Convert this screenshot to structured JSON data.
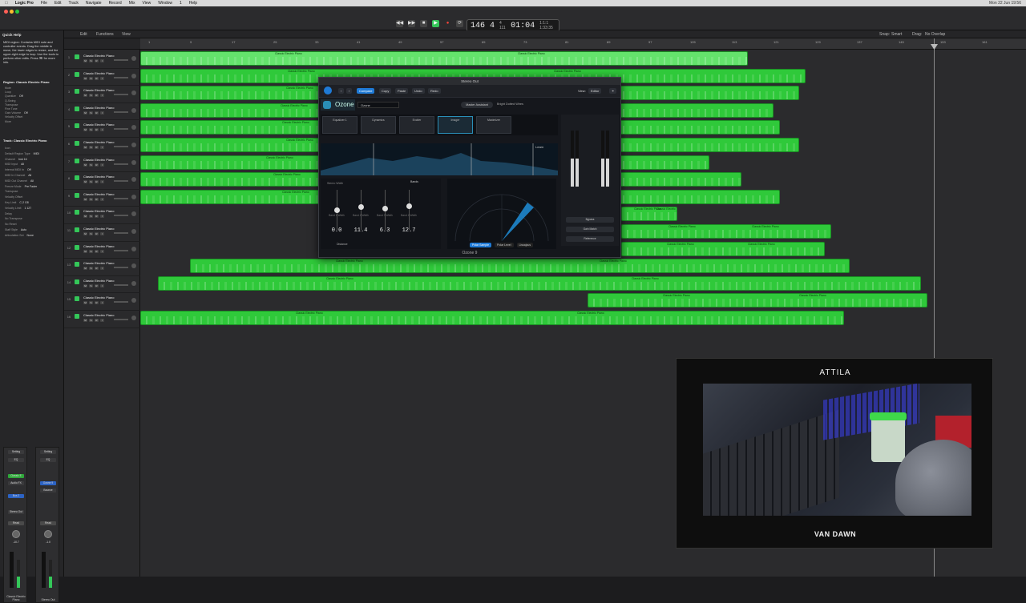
{
  "menubar": {
    "app": "Logic Pro",
    "items": [
      "File",
      "Edit",
      "Track",
      "Navigate",
      "Record",
      "Mix",
      "View",
      "Window",
      "1",
      "Help"
    ],
    "clock": "Mon 22 Jun 19:56"
  },
  "window": {
    "title": "Stereo Out"
  },
  "lcd": {
    "tempo": "146",
    "sig": "4",
    "sig_sub": "4 111",
    "position": "01:04",
    "small": "1:1:1 1:33:35"
  },
  "toolbar2": {
    "edit": "Edit",
    "functions": "Functions",
    "view": "View",
    "snap_label": "Snap:",
    "snap_value": "Smart",
    "drag_label": "Drag:",
    "drag_value": "No Overlap"
  },
  "inspector": {
    "quick_help_title": "Quick Help",
    "help_text": "MIDI region: Contains MIDI note and controller events. Drag the middle to move, the lower edges to resize, and the upper-right edge to loop. Use the tools to perform other edits. Press ⌘/ for more info.",
    "region_title": "Region: Classic Electric Piano",
    "region_fields": [
      {
        "k": "Mute",
        "v": ""
      },
      {
        "k": "Loop",
        "v": ""
      },
      {
        "k": "Quantize",
        "v": "Off"
      },
      {
        "k": "Q-Swing",
        "v": ""
      },
      {
        "k": "Transpose",
        "v": ""
      },
      {
        "k": "Fine Tune",
        "v": ""
      },
      {
        "k": "Gain Volume",
        "v": "Off"
      },
      {
        "k": "Velocity Offset",
        "v": ""
      },
      {
        "k": "More",
        "v": ""
      }
    ],
    "track_title": "Track: Classic Electric Piano",
    "track_fields": [
      {
        "k": "Icon",
        "v": ""
      },
      {
        "k": "Default Region Type",
        "v": "MIDI"
      },
      {
        "k": "Channel",
        "v": "Inst 16"
      },
      {
        "k": "MIDI Input",
        "v": "All"
      },
      {
        "k": "Internal MIDI In",
        "v": "Off"
      },
      {
        "k": "MIDI In Channel",
        "v": "All"
      },
      {
        "k": "MIDI Out Channel",
        "v": "All"
      },
      {
        "k": "Freeze Mode",
        "v": "Pre Fader"
      },
      {
        "k": "Transpose",
        "v": ""
      },
      {
        "k": "Velocity Offset",
        "v": ""
      },
      {
        "k": "Key Limit",
        "v": "C-2 G8"
      },
      {
        "k": "Velocity Limit",
        "v": "1 127"
      },
      {
        "k": "Delay",
        "v": ""
      },
      {
        "k": "No Transpose",
        "v": ""
      },
      {
        "k": "No Reset",
        "v": ""
      },
      {
        "k": "Staff Style",
        "v": "Auto"
      },
      {
        "k": "Articulation Set",
        "v": "None"
      }
    ],
    "strips": [
      {
        "setting": "Setting",
        "eq": "EQ",
        "plugin": "Classic E",
        "audio_fx": "Audio FX",
        "bus": "Bus 2",
        "stereo": "Stereo Out",
        "read": "Read",
        "pan": "0.0",
        "level": "-10.7",
        "name": "Classic Electric Piano"
      },
      {
        "setting": "Setting",
        "eq": "EQ",
        "plugin": "Ozone 9",
        "audio_fx": "Bounce",
        "bus": "",
        "stereo": "",
        "read": "Read",
        "pan": "0.0",
        "level": "-1.0",
        "name": "Stereo Out"
      }
    ]
  },
  "tracks": [
    {
      "num": "1",
      "name": "Classic Electric Piano"
    },
    {
      "num": "2",
      "name": "Classic Electric Piano"
    },
    {
      "num": "3",
      "name": "Classic Electric Piano"
    },
    {
      "num": "4",
      "name": "Classic Electric Piano"
    },
    {
      "num": "5",
      "name": "Classic Electric Piano"
    },
    {
      "num": "6",
      "name": "Classic Electric Piano"
    },
    {
      "num": "7",
      "name": "Classic Electric Piano"
    },
    {
      "num": "8",
      "name": "Classic Electric Piano"
    },
    {
      "num": "9",
      "name": "Classic Electric Piano"
    },
    {
      "num": "10",
      "name": "Classic Electric Piano"
    },
    {
      "num": "11",
      "name": "Classic Electric Piano"
    },
    {
      "num": "12",
      "name": "Classic Electric Piano"
    },
    {
      "num": "13",
      "name": "Classic Electric Piano"
    },
    {
      "num": "14",
      "name": "Classic Electric Piano"
    },
    {
      "num": "15",
      "name": "Classic Electric Piano"
    },
    {
      "num": "16",
      "name": "Classic Electric Piano"
    }
  ],
  "track_buttons": [
    "M",
    "S",
    "R",
    "I"
  ],
  "ruler": [
    "1",
    "9",
    "17",
    "25",
    "33",
    "41",
    "49",
    "57",
    "65",
    "73",
    "81",
    "89",
    "97",
    "105",
    "113",
    "121",
    "129",
    "137",
    "145",
    "153",
    "161"
  ],
  "region_label": "Classic Electric Piano",
  "plugin": {
    "window_title": "Stereo Out",
    "nav": [
      "Compare",
      "Copy",
      "Paste",
      "Undo",
      "Redo"
    ],
    "view_label": "View:",
    "view_value": "Editor",
    "brand": "Ozone",
    "preset": "Ozone",
    "assistant": "Master Assistant",
    "assistant_info": "Bright Dotted Wires",
    "modules": [
      "Equalizer 1",
      "Dynamics",
      "Exciter",
      "Imager",
      "Maximizer"
    ],
    "learn": "Learn",
    "bands_label": "Stereo Width",
    "bands_add": "Bands",
    "bands": [
      {
        "label": "Band 1 Width",
        "value": "0.0"
      },
      {
        "label": "Band 2 Width",
        "value": "11.4"
      },
      {
        "label": "Band 3 Width",
        "value": "6.3"
      },
      {
        "label": "Band 4 Width",
        "value": "12.7"
      }
    ],
    "distance": "Distance",
    "scope_tabs": [
      "Polar Sample",
      "Polar Level",
      "Lissajous"
    ],
    "io_buttons": [
      "Bypass",
      "Gain Match",
      "Reference"
    ],
    "footer": "Ozone 9"
  },
  "webcam": {
    "title": "ATTILA",
    "caption": "VAN DAWN"
  },
  "colors": {
    "region_green": "#2fc93a",
    "region_green_selected": "#64e36c",
    "accent_blue": "#1f7ad6",
    "play_green": "#34c759",
    "record_red": "#ff453a"
  }
}
